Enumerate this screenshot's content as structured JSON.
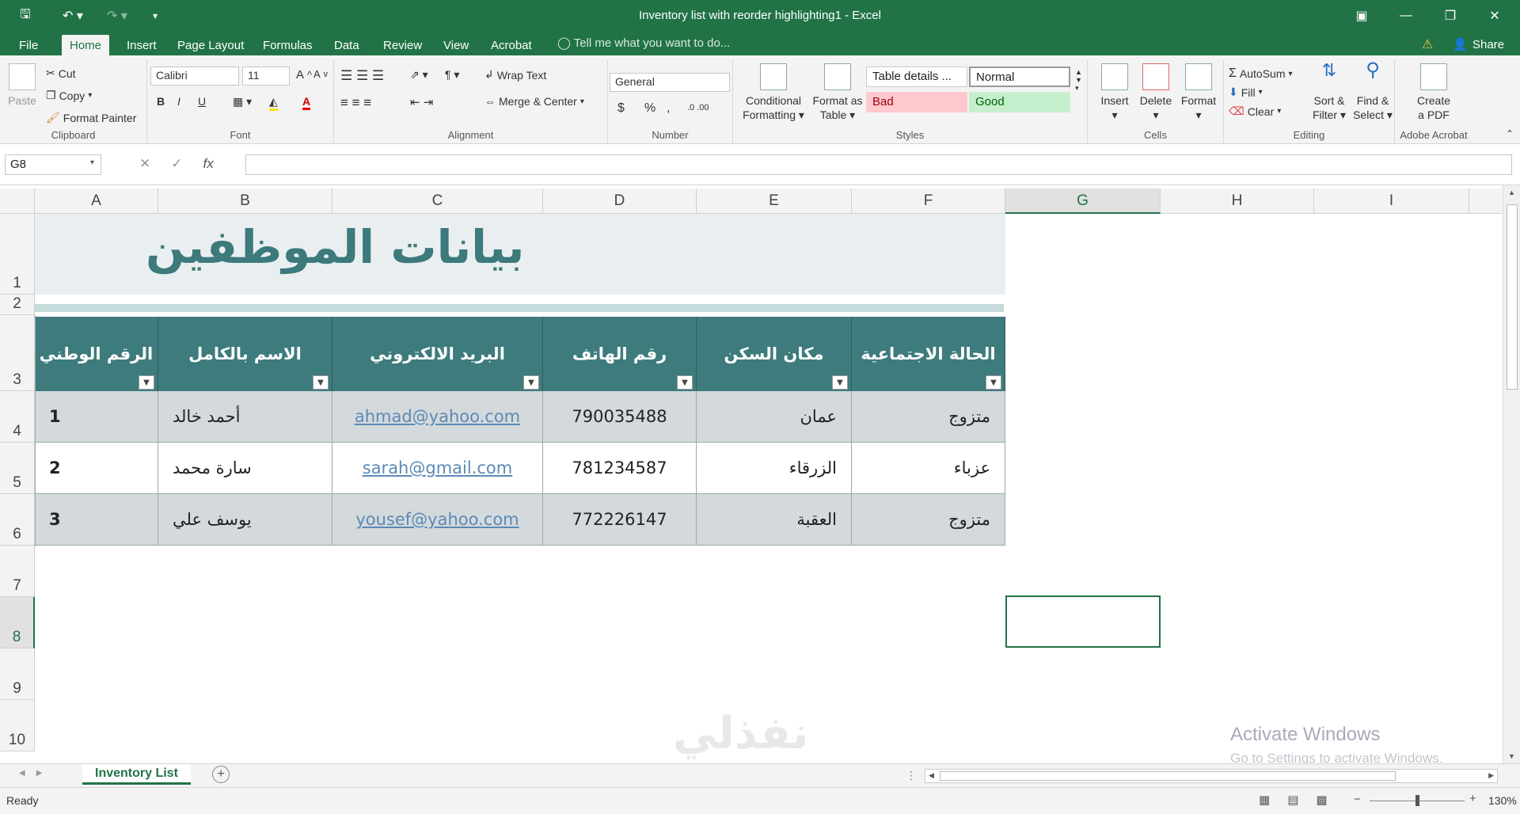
{
  "window": {
    "title": "Inventory list with reorder highlighting1 - Excel"
  },
  "tabs": [
    {
      "label": "File"
    },
    {
      "label": "Home"
    },
    {
      "label": "Insert"
    },
    {
      "label": "Page Layout"
    },
    {
      "label": "Formulas"
    },
    {
      "label": "Data"
    },
    {
      "label": "Review"
    },
    {
      "label": "View"
    },
    {
      "label": "Acrobat"
    }
  ],
  "tell_me": "Tell me what you want to do...",
  "share": "Share",
  "clipboard": {
    "paste": "Paste",
    "cut": "Cut",
    "copy": "Copy",
    "format_painter": "Format Painter",
    "label": "Clipboard"
  },
  "font": {
    "name": "Calibri",
    "size": "11",
    "label": "Font",
    "bold": "B",
    "italic": "I",
    "underline": "U"
  },
  "alignment": {
    "wrap": "Wrap Text",
    "merge": "Merge & Center",
    "label": "Alignment"
  },
  "number": {
    "format": "General",
    "label": "Number",
    "currency": "$",
    "percent": "%",
    "comma": ","
  },
  "styles": {
    "conditional": "Conditional",
    "conditional2": "Formatting",
    "format_table": "Format as",
    "format_table2": "Table",
    "table_details": "Table details ...",
    "normal": "Normal",
    "bad": "Bad",
    "good": "Good",
    "label": "Styles"
  },
  "cells": {
    "insert": "Insert",
    "delete": "Delete",
    "format": "Format",
    "label": "Cells"
  },
  "editing": {
    "autosum": "AutoSum",
    "fill": "Fill",
    "clear": "Clear",
    "sort": "Sort &",
    "sort2": "Filter",
    "find": "Find &",
    "find2": "Select",
    "label": "Editing"
  },
  "acrobat": {
    "create": "Create",
    "create2": "a PDF",
    "label": "Adobe Acrobat"
  },
  "formula_bar": {
    "namebox": "G8",
    "fx": "fx"
  },
  "columns": [
    "A",
    "B",
    "C",
    "D",
    "E",
    "F",
    "G",
    "H",
    "I"
  ],
  "rows": [
    "1",
    "2",
    "3",
    "4",
    "5",
    "6",
    "7",
    "8",
    "9",
    "10"
  ],
  "sheet_title": "بيانات الموظفين",
  "headers": [
    "الرقم الوطني",
    "الاسم بالكامل",
    "البريد الالكتروني",
    "رقم الهاتف",
    "مكان السكن",
    "الحالة الاجتماعية"
  ],
  "data_rows": [
    {
      "id": "1",
      "name": "أحمد خالد",
      "email": "ahmad@yahoo.com",
      "phone": "790035488",
      "city": "عمان",
      "status": "متزوج"
    },
    {
      "id": "2",
      "name": "سارة محمد",
      "email": "sarah@gmail.com",
      "phone": "781234587",
      "city": "الزرقاء",
      "status": "عزباء"
    },
    {
      "id": "3",
      "name": "يوسف علي",
      "email": "yousef@yahoo.com",
      "phone": "772226147",
      "city": "العقبة",
      "status": "متزوج"
    }
  ],
  "watermark": {
    "line1": "Activate Windows",
    "line2": "Go to Settings to activate Windows."
  },
  "brand": "نفذلي",
  "sheet_tab": "Inventory List",
  "status": {
    "ready": "Ready",
    "zoom": "130%"
  }
}
